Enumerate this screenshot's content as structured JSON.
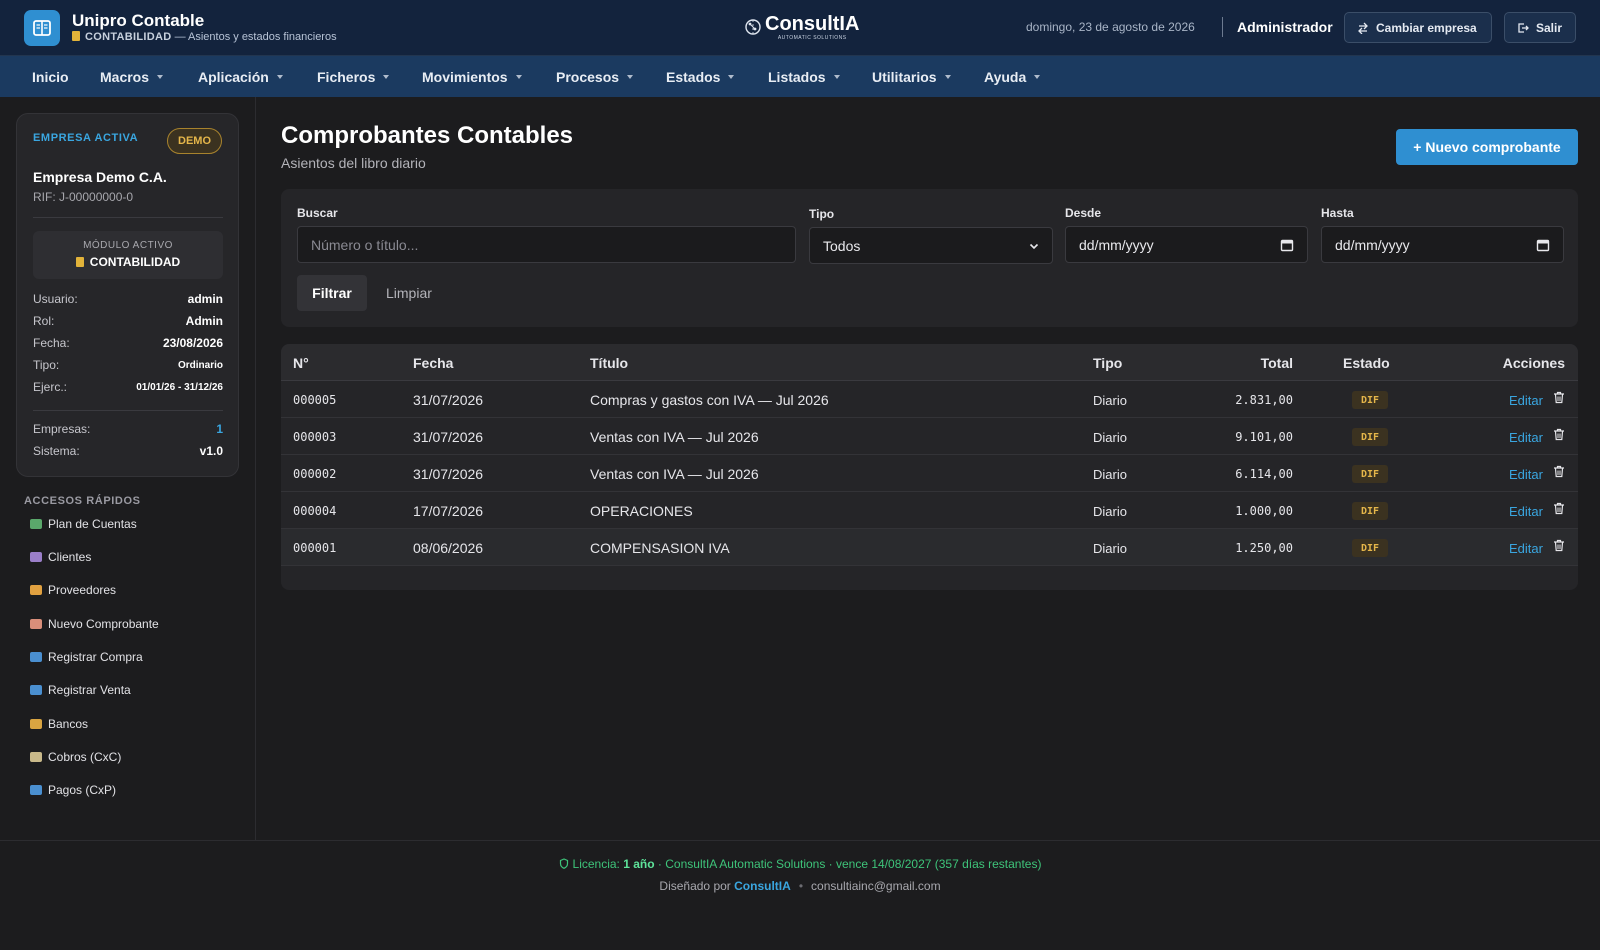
{
  "header": {
    "app_title": "Unipro Contable",
    "module_tag": "CONTABILIDAD",
    "module_desc": "— Asientos y estados financieros",
    "logo_text": "ConsultIA",
    "logo_tagline": "AUTOMATIC SOLUTIONS",
    "date": "domingo, 23 de agosto de 2026",
    "user": "Administrador",
    "switch_company_label": "Cambiar empresa",
    "logout_label": "Salir"
  },
  "nav": {
    "items": [
      {
        "label": "Inicio"
      },
      {
        "label": "Macros"
      },
      {
        "label": "Aplicación"
      },
      {
        "label": "Ficheros"
      },
      {
        "label": "Movimientos"
      },
      {
        "label": "Procesos"
      },
      {
        "label": "Estados"
      },
      {
        "label": "Listados"
      },
      {
        "label": "Utilitarios"
      },
      {
        "label": "Ayuda"
      }
    ]
  },
  "sidebar": {
    "active_label": "EMPRESA ACTIVA",
    "badge": "DEMO",
    "company_name": "Empresa Demo C.A.",
    "rif": "RIF: J-00000000-0",
    "module_label": "MÓDULO ACTIVO",
    "module_name": "CONTABILIDAD",
    "info": [
      {
        "key": "Usuario:",
        "value": "admin"
      },
      {
        "key": "Rol:",
        "value": "Admin"
      },
      {
        "key": "Fecha:",
        "value": "23/08/2026"
      },
      {
        "key": "Tipo:",
        "value": "Ordinario"
      },
      {
        "key": "Ejerc.:",
        "value": "01/01/26 - 31/12/26"
      }
    ],
    "stats": [
      {
        "key": "Empresas:",
        "value": "1"
      },
      {
        "key": "Sistema:",
        "value": "v1.0"
      }
    ],
    "quick_title": "ACCESOS RÁPIDOS",
    "quick_links": [
      {
        "label": "Plan de Cuentas",
        "icon": "chart-icon",
        "color": "#5aa86b"
      },
      {
        "label": "Clientes",
        "icon": "users-icon",
        "color": "#9b7fc9"
      },
      {
        "label": "Proveedores",
        "icon": "truck-icon",
        "color": "#e0a040"
      },
      {
        "label": "Nuevo Comprobante",
        "icon": "document-icon",
        "color": "#d98e7a"
      },
      {
        "label": "Registrar Compra",
        "icon": "cart-icon",
        "color": "#4a8fd0"
      },
      {
        "label": "Registrar Venta",
        "icon": "shop-icon",
        "color": "#4a8fd0"
      },
      {
        "label": "Bancos",
        "icon": "money-bag-icon",
        "color": "#d9a441"
      },
      {
        "label": "Cobros (CxC)",
        "icon": "clipboard-icon",
        "color": "#c9b98a"
      },
      {
        "label": "Pagos (CxP)",
        "icon": "card-icon",
        "color": "#4a8fd0"
      }
    ]
  },
  "main": {
    "title": "Comprobantes Contables",
    "subtitle": "Asientos del libro diario",
    "new_button": "+ Nuevo comprobante",
    "filters": {
      "search_label": "Buscar",
      "search_placeholder": "Número o título...",
      "type_label": "Tipo",
      "type_value": "Todos",
      "from_label": "Desde",
      "from_value": "dd/mm/yyyy",
      "to_label": "Hasta",
      "to_value": "dd/mm/yyyy",
      "filter_button": "Filtrar",
      "clear_button": "Limpiar"
    },
    "table": {
      "columns": [
        "N°",
        "Fecha",
        "Título",
        "Tipo",
        "Total",
        "Estado",
        "Acciones"
      ],
      "edit_label": "Editar",
      "rows": [
        {
          "num": "000005",
          "fecha": "31/07/2026",
          "titulo": "Compras y gastos con IVA — Jul 2026",
          "tipo": "Diario",
          "total": "2.831,00",
          "estado": "DIF"
        },
        {
          "num": "000003",
          "fecha": "31/07/2026",
          "titulo": "Ventas con IVA — Jul 2026",
          "tipo": "Diario",
          "total": "9.101,00",
          "estado": "DIF"
        },
        {
          "num": "000002",
          "fecha": "31/07/2026",
          "titulo": "Ventas con IVA — Jul 2026",
          "tipo": "Diario",
          "total": "6.114,00",
          "estado": "DIF"
        },
        {
          "num": "000004",
          "fecha": "17/07/2026",
          "titulo": "OPERACIONES",
          "tipo": "Diario",
          "total": "1.000,00",
          "estado": "DIF"
        },
        {
          "num": "000001",
          "fecha": "08/06/2026",
          "titulo": "COMPENSASION IVA",
          "tipo": "Diario",
          "total": "1.250,00",
          "estado": "DIF"
        }
      ]
    }
  },
  "footer": {
    "license_prefix": "Licencia:",
    "license_term": "1 año",
    "license_rest": "· ConsultIA Automatic Solutions · vence 14/08/2027 (357 días restantes)",
    "designed_by": "Diseñado por",
    "designer": "ConsultIA",
    "separator": "•",
    "email": "consultiainc@gmail.com"
  },
  "colors": {
    "accent": "#2f8fd1",
    "header_bg": "#13233d",
    "nav_bg": "#1b3a60",
    "warning": "#e5b64a",
    "success": "#3ec47a"
  }
}
